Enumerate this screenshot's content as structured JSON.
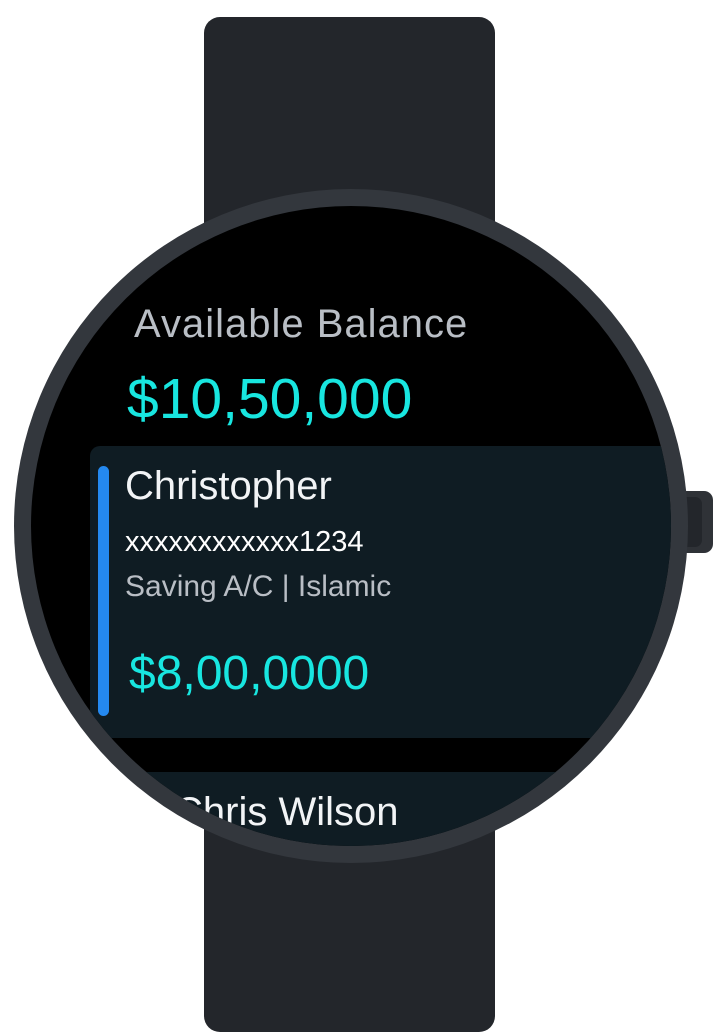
{
  "balance": {
    "label": "Available Balance",
    "amount": "$10,50,000"
  },
  "accounts": [
    {
      "name": "Christopher",
      "number": "xxxxxxxxxxxx1234",
      "type": "Saving A/C | Islamic",
      "amount": "$8,00,0000"
    },
    {
      "name": "Chris Wilson"
    }
  ],
  "colors": {
    "accent": "#18e6e0",
    "indicator": "#2489f0",
    "card_bg": "#0f1c23",
    "screen_bg": "#000000",
    "strap": "#23262b"
  }
}
